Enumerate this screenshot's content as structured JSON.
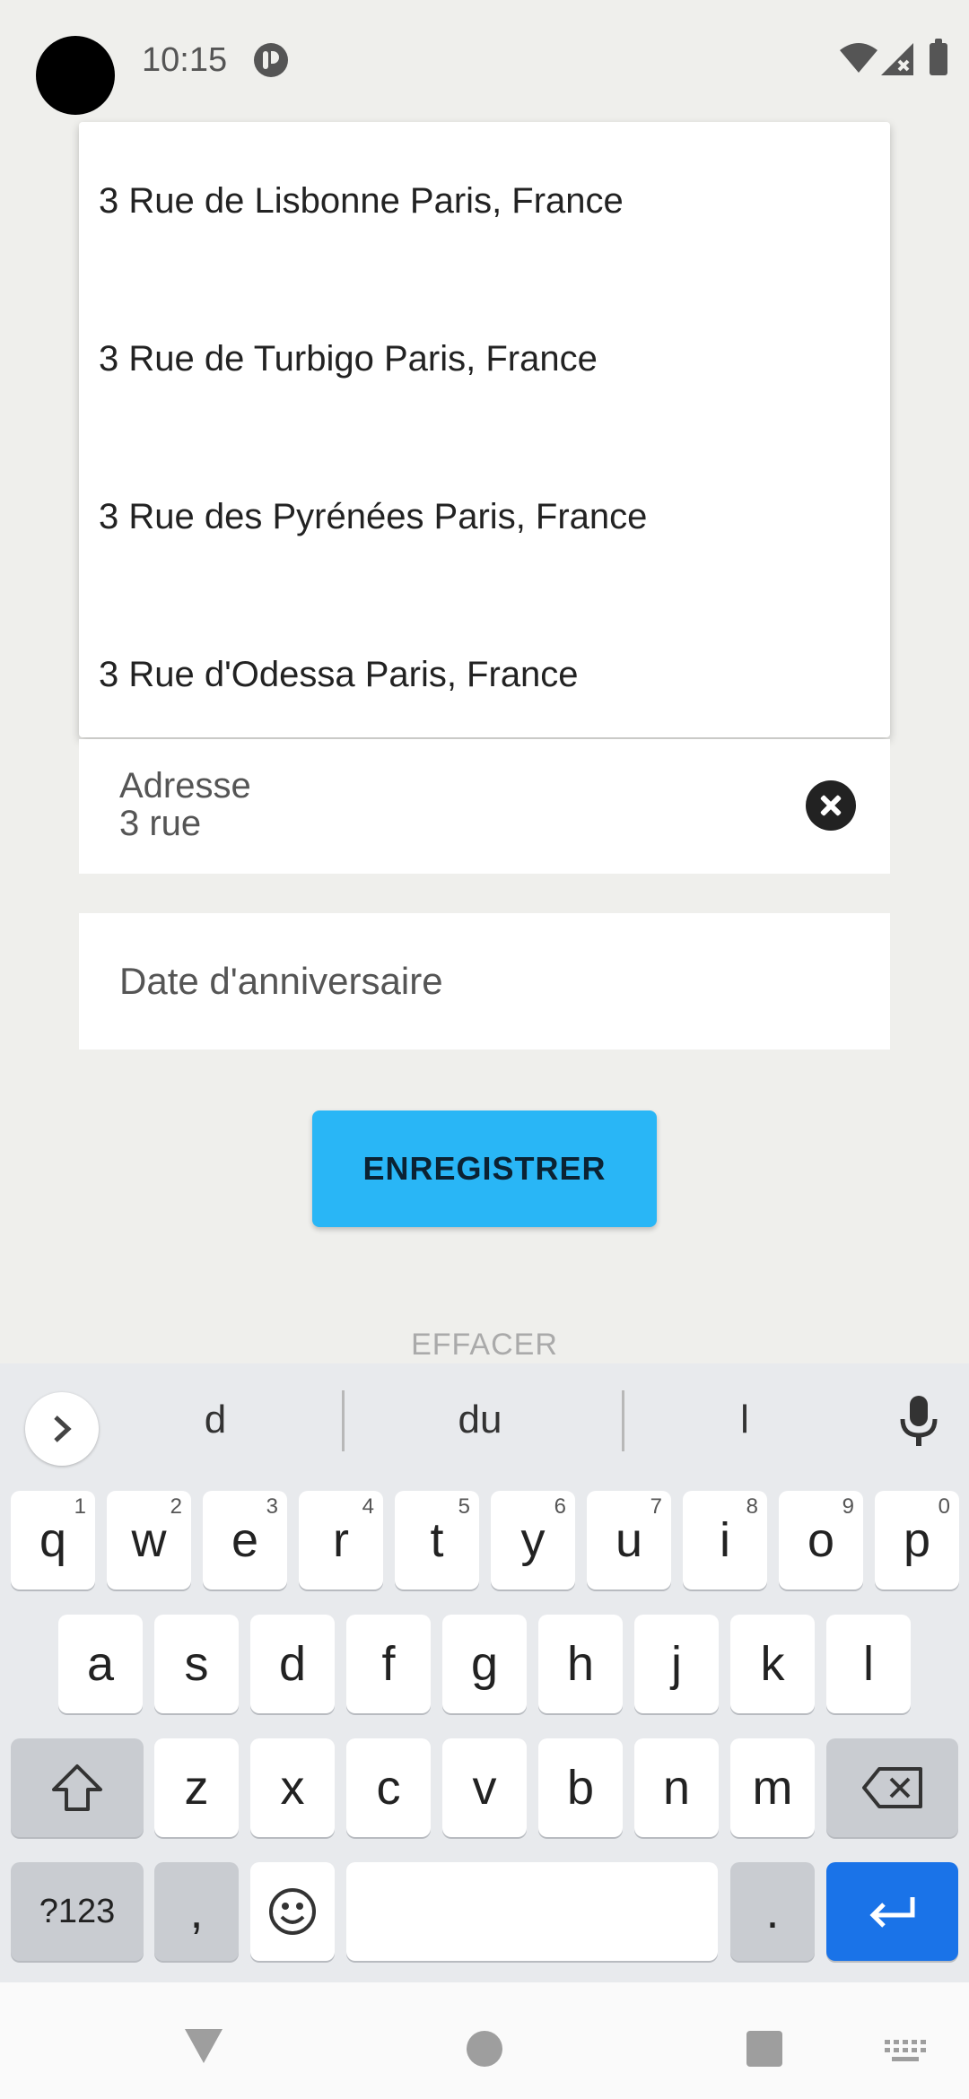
{
  "status_bar": {
    "time": "10:15",
    "icons": [
      "camera-cutout",
      "app-notification-icon",
      "wifi-icon",
      "signal-icon",
      "battery-icon"
    ]
  },
  "address_suggestions": [
    "3 Rue de Lisbonne Paris, France",
    "3 Rue de Turbigo Paris, France",
    "3 Rue des Pyrénées Paris, France",
    "3 Rue d'Odessa Paris, France"
  ],
  "form": {
    "address_label": "Adresse",
    "address_value": "3 rue",
    "birthday_placeholder": "Date d'anniversaire",
    "save_label": "ENREGISTRER",
    "clear_label": "EFFACER"
  },
  "keyboard": {
    "suggestions": [
      "d",
      "du",
      "l"
    ],
    "row1": [
      {
        "key": "q",
        "hint": "1"
      },
      {
        "key": "w",
        "hint": "2"
      },
      {
        "key": "e",
        "hint": "3"
      },
      {
        "key": "r",
        "hint": "4"
      },
      {
        "key": "t",
        "hint": "5"
      },
      {
        "key": "y",
        "hint": "6"
      },
      {
        "key": "u",
        "hint": "7"
      },
      {
        "key": "i",
        "hint": "8"
      },
      {
        "key": "o",
        "hint": "9"
      },
      {
        "key": "p",
        "hint": "0"
      }
    ],
    "row2": [
      "a",
      "s",
      "d",
      "f",
      "g",
      "h",
      "j",
      "k",
      "l"
    ],
    "row3": [
      "z",
      "x",
      "c",
      "v",
      "b",
      "n",
      "m"
    ],
    "symbols_label": "?123",
    "comma_label": ",",
    "period_label": ".",
    "enter_color": "#1a73e8"
  },
  "colors": {
    "accent": "#29b6f6",
    "background": "#efefec",
    "keyboard_bg": "#e8eaed"
  }
}
